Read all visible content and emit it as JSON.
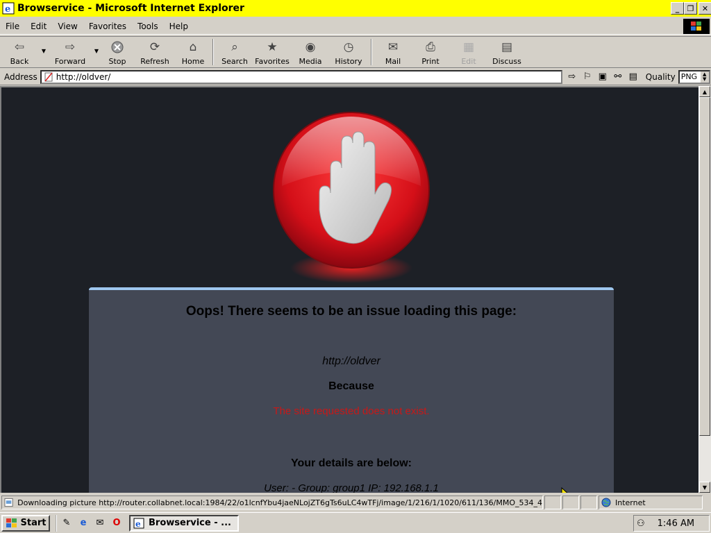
{
  "window": {
    "title": "Browservice - Microsoft Internet Explorer",
    "controls": [
      "minimize",
      "restore",
      "close"
    ]
  },
  "menu": [
    "File",
    "Edit",
    "View",
    "Favorites",
    "Tools",
    "Help"
  ],
  "toolbar": {
    "back": "Back",
    "forward": "Forward",
    "stop": "Stop",
    "refresh": "Refresh",
    "home": "Home",
    "search": "Search",
    "favorites": "Favorites",
    "media": "Media",
    "history": "History",
    "mail": "Mail",
    "print": "Print",
    "edit": "Edit",
    "discuss": "Discuss"
  },
  "address": {
    "label": "Address",
    "url": "http://oldver/",
    "quality_label": "Quality",
    "quality_value": "PNG"
  },
  "page": {
    "heading": "Oops! There seems to be an issue loading this page:",
    "url": "http://oldver",
    "because": "Because",
    "reason": "The site requested does not exist.",
    "details_heading": "Your details are below:",
    "details": "User: -   Group: group1   IP: 192.168.1.1"
  },
  "status": {
    "message": "Downloading picture http://router.collabnet.local:1984/22/o1lcnfYbu4jaeNLojZT6gTs6uLC4wTFj/image/1/216/1/1020/611/136/MMO_534_4",
    "zone": "Internet"
  },
  "taskbar": {
    "start": "Start",
    "task": "Browservice - ...",
    "clock": "1:46 AM"
  },
  "colors": {
    "title_bar": "#ffff00",
    "content_bg": "#1d2026",
    "card_bg": "#434855",
    "card_top_border": "#9fc7ef",
    "reason_red": "#c81818"
  }
}
